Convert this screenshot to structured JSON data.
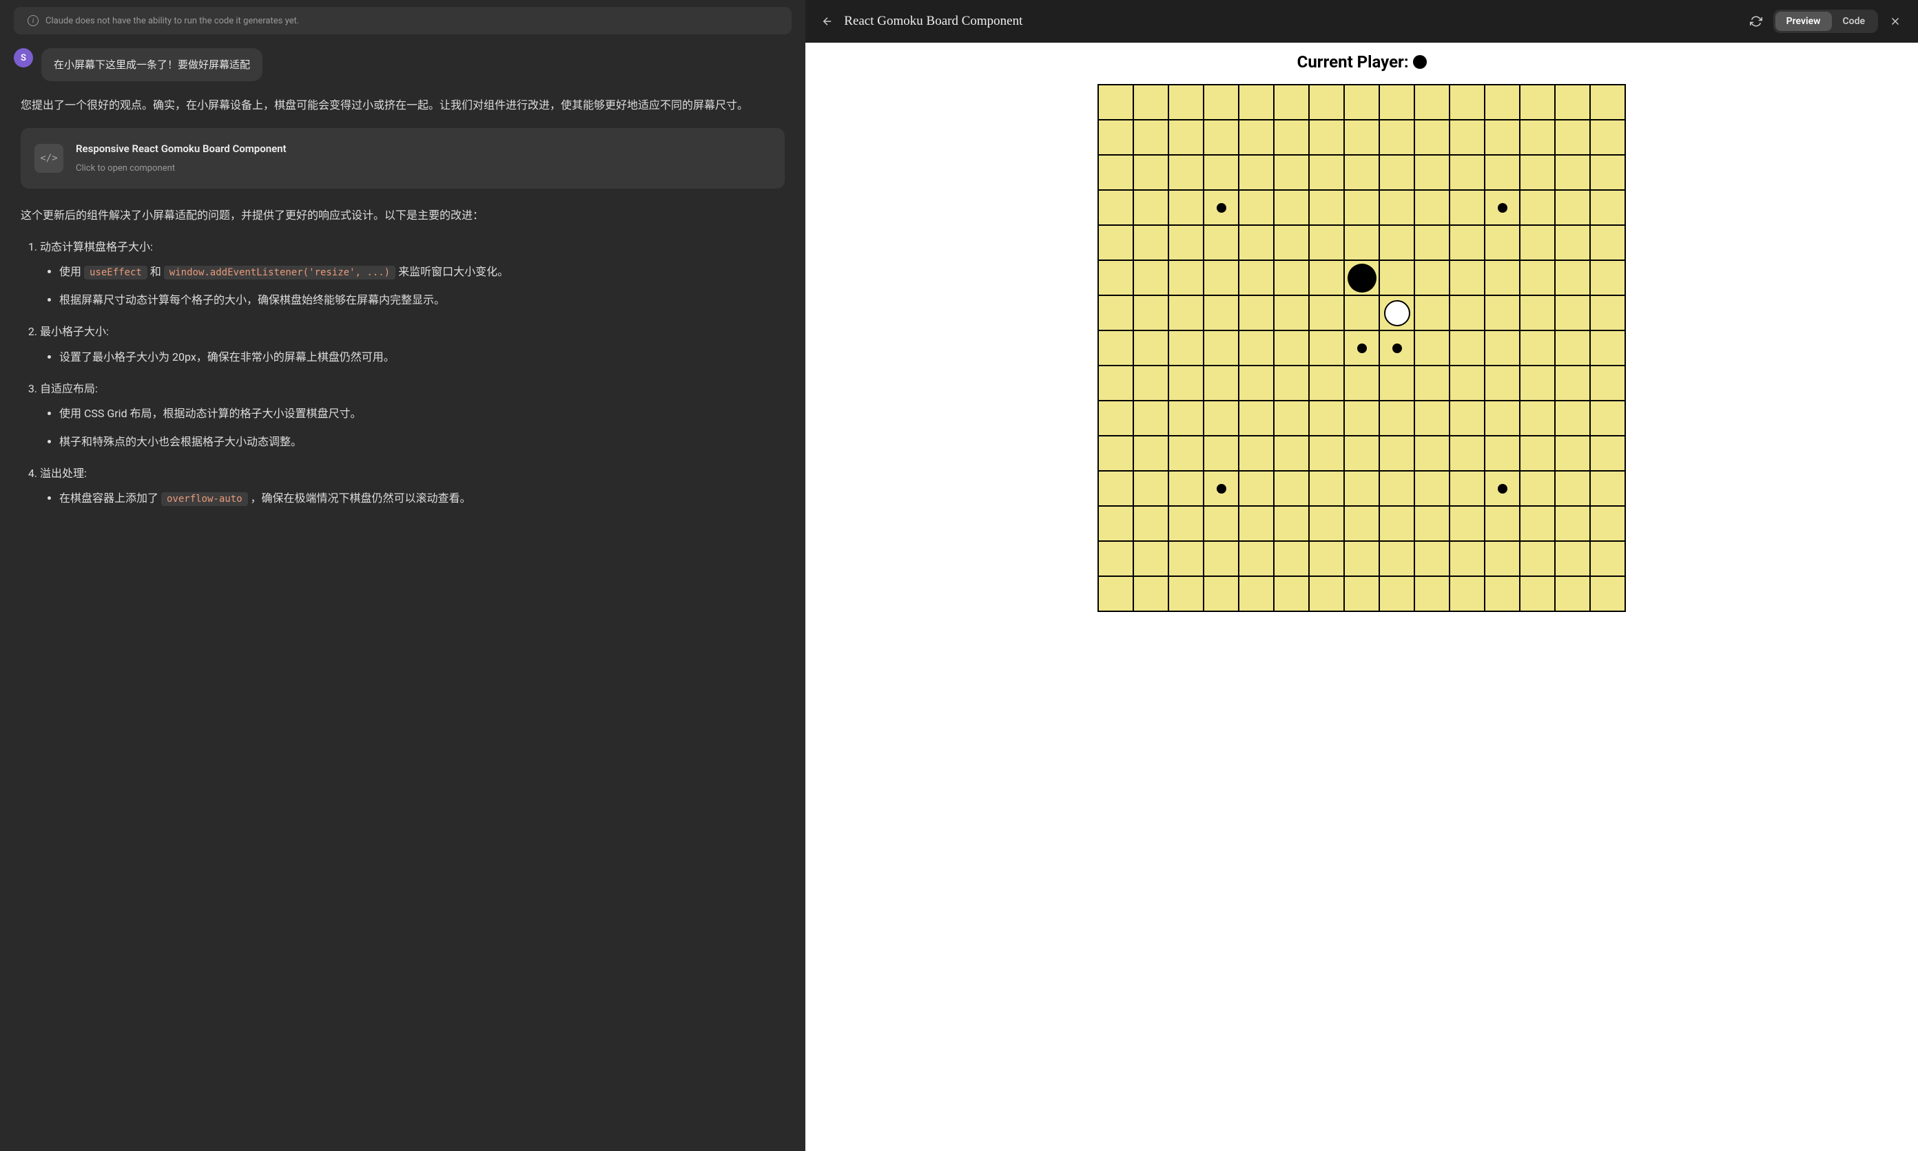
{
  "notice": {
    "text": "Claude does not have the ability to run the code it generates yet."
  },
  "user": {
    "avatar_letter": "S",
    "message": "在小屏幕下这里成一条了！要做好屏幕适配"
  },
  "assistant": {
    "intro": "您提出了一个很好的观点。确实，在小屏幕设备上，棋盘可能会变得过小或挤在一起。让我们对组件进行改进，使其能够更好地适应不同的屏幕尺寸。",
    "artifact": {
      "title": "Responsive React Gomoku Board Component",
      "subtitle": "Click to open component"
    },
    "after_artifact": "这个更新后的组件解决了小屏幕适配的问题，并提供了更好的响应式设计。以下是主要的改进：",
    "points": [
      {
        "title": "动态计算棋盘格子大小:",
        "items": [
          {
            "prefix": "使用 ",
            "code1": "useEffect",
            "mid": " 和 ",
            "code2": "window.addEventListener('resize', ...)",
            "suffix": " 来监听窗口大小变化。"
          },
          {
            "text": "根据屏幕尺寸动态计算每个格子的大小，确保棋盘始终能够在屏幕内完整显示。"
          }
        ]
      },
      {
        "title": "最小格子大小:",
        "items": [
          {
            "text": "设置了最小格子大小为 20px，确保在非常小的屏幕上棋盘仍然可用。"
          }
        ]
      },
      {
        "title": "自适应布局:",
        "items": [
          {
            "text": "使用 CSS Grid 布局，根据动态计算的格子大小设置棋盘尺寸。"
          },
          {
            "text": "棋子和特殊点的大小也会根据格子大小动态调整。"
          }
        ]
      },
      {
        "title": "溢出处理:",
        "items": [
          {
            "prefix": "在棋盘容器上添加了 ",
            "code1": "overflow-auto",
            "suffix": " ，确保在极端情况下棋盘仍然可以滚动查看。"
          }
        ]
      }
    ]
  },
  "preview": {
    "title": "React Gomoku Board Component",
    "tabs": {
      "preview": "Preview",
      "code": "Code"
    },
    "current_player_label": "Current Player:",
    "board": {
      "size": 15,
      "star_points": [
        [
          3,
          3
        ],
        [
          3,
          11
        ],
        [
          7,
          7
        ],
        [
          11,
          3
        ],
        [
          11,
          11
        ]
      ],
      "stones": [
        {
          "row": 5,
          "col": 7,
          "color": "black",
          "large": true
        },
        {
          "row": 6,
          "col": 8,
          "color": "white"
        },
        {
          "row": 7,
          "col": 8,
          "color": "black",
          "star": true
        }
      ]
    }
  }
}
